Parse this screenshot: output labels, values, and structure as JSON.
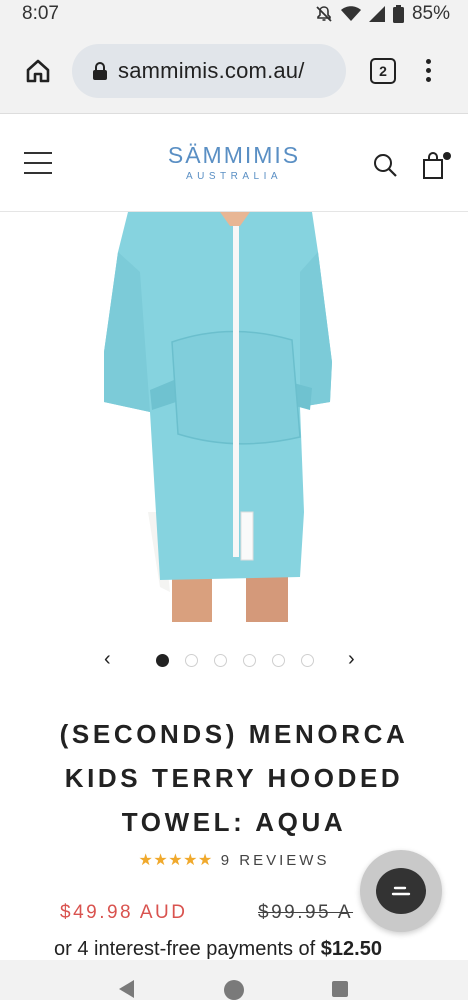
{
  "status_bar": {
    "time": "8:07",
    "battery": "85%"
  },
  "browser": {
    "url": "sammimis.com.au/",
    "tab_count": "2"
  },
  "site": {
    "logo_main": "SÄMMIMIS",
    "logo_sub": "AUSTRALIA"
  },
  "carousel": {
    "prev_label": "‹",
    "next_label": "›",
    "slide_count": 6,
    "active_index": 0
  },
  "product": {
    "title": "(SECONDS) MENORCA KIDS TERRY HOODED TOWEL: AQUA",
    "rating": 5,
    "stars": "★★★★★",
    "reviews_label": "9 REVIEWS",
    "sale_price": "$49.98 AUD",
    "original_price": "$99.95 A",
    "installments_prefix": "or 4 interest-free payments of ",
    "installments_amount": "$12.50"
  },
  "colors": {
    "brand": "#5a8fc4",
    "sale": "#d9534f",
    "stars": "#f0a92c",
    "towel": "#7fd6e3"
  }
}
